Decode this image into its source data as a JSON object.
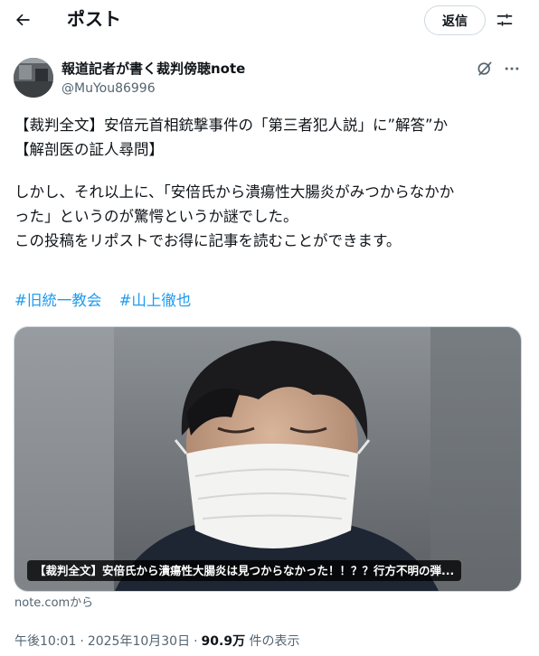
{
  "header": {
    "back_icon": "arrow-left-icon",
    "title": "ポスト",
    "reply_label": "返信",
    "filter_icon": "sliders-icon"
  },
  "author": {
    "name": "報道記者が書く裁判傍聴note",
    "handle": "@MuYou86996",
    "grok_icon": "grok-icon",
    "more_icon": "more-dots-icon"
  },
  "post": {
    "lines": [
      "【裁判全文】安倍元首相銃撃事件の「第三者犯人説」に”解答”か",
      "【解剖医の証人尋問】",
      "しかし、それ以上に、「安倍氏から潰瘍性大腸炎がみつからなかか",
      "った」というのが驚愕というか謎でした。",
      "この投稿をリポストでお得に記事を読むことができます。"
    ],
    "hashtags": [
      "#旧統一教会",
      "#山上徹也"
    ]
  },
  "card": {
    "caption": "【裁判全文】安倍氏から潰瘍性大腸炎は見つからなかった！！？？行方不明の弾...",
    "source": "note.comから"
  },
  "meta": {
    "time": "午後10:01",
    "date": "2025年10月30日",
    "views_count": "90.9万",
    "views_label": "件の表示",
    "separator": "·"
  },
  "colors": {
    "accent": "#1d9bf0",
    "secondary_text": "#536471",
    "border": "#cfd9de"
  }
}
